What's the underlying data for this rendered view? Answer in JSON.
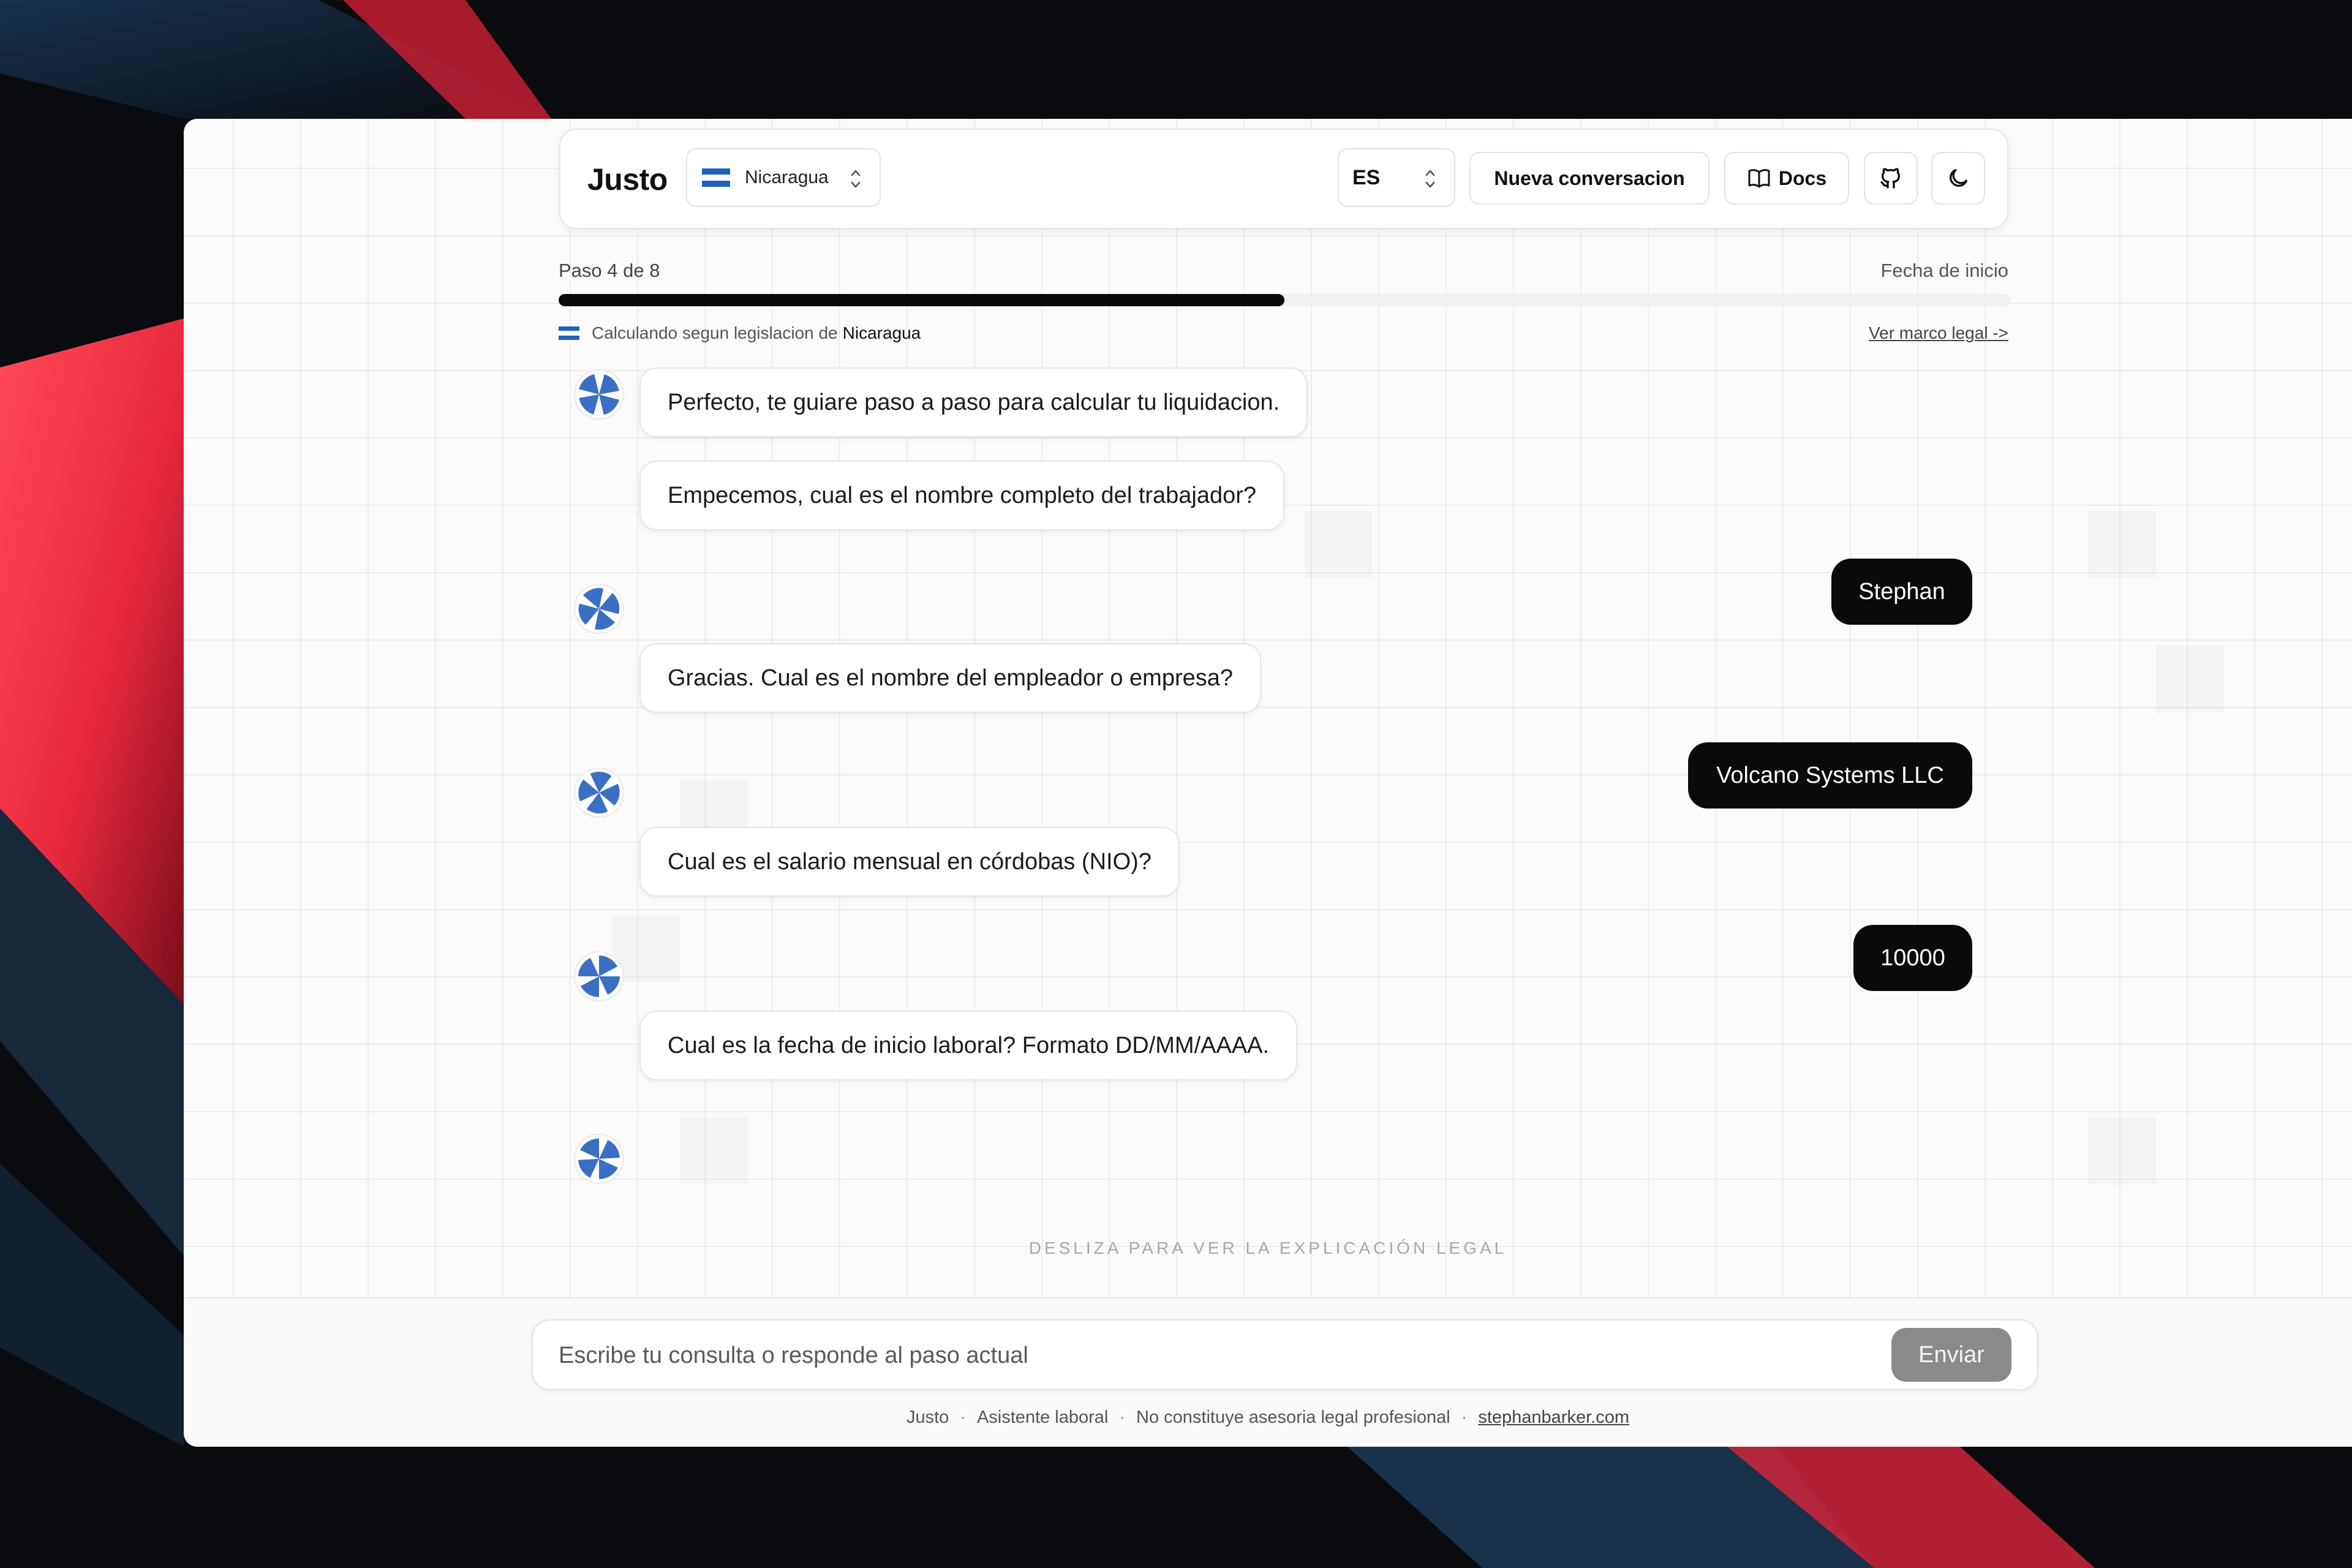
{
  "app": {
    "brand": "Justo",
    "country_selector": {
      "value": "Nicaragua"
    },
    "language_selector": {
      "value": "ES"
    },
    "buttons": {
      "new_conversation": "Nueva conversacion",
      "docs": "Docs"
    },
    "icons": {
      "github": "github-icon",
      "theme": "moon-icon",
      "docs": "book-icon",
      "flag": "nicaragua-flag-icon"
    }
  },
  "progress": {
    "step_label": "Paso 4 de 8",
    "current_field": "Fecha de inicio",
    "fraction": 0.5
  },
  "jurisdiction": {
    "prefix": "Calculando segun legislacion de",
    "country": "Nicaragua",
    "legal_link": "Ver marco legal ->"
  },
  "messages": [
    {
      "role": "bot",
      "text": "Perfecto, te guiare paso a paso para calcular tu liquidacion."
    },
    {
      "role": "bot",
      "text": "Empecemos, cual es el nombre completo del trabajador?"
    },
    {
      "role": "user",
      "text": "Stephan"
    },
    {
      "role": "bot",
      "text": "Gracias. Cual es el nombre del empleador o empresa?"
    },
    {
      "role": "user",
      "text": "Volcano Systems LLC"
    },
    {
      "role": "bot",
      "text": "Cual es el salario mensual en córdobas (NIO)?"
    },
    {
      "role": "user",
      "text": "10000"
    },
    {
      "role": "bot",
      "text": "Cual es la fecha de inicio laboral? Formato DD/MM/AAAA."
    }
  ],
  "swipe_hint": "DESLIZA PARA VER LA EXPLICACIÓN LEGAL",
  "composer": {
    "placeholder": "Escribe tu consulta o responde al paso actual",
    "send_label": "Enviar"
  },
  "footer": {
    "items": [
      "Justo",
      "Asistente laboral",
      "No constituye asesoria legal profesional"
    ],
    "link": "stephanbarker.com"
  },
  "colors": {
    "accent_dark": "#0a0a0a",
    "avatar_blue": "#3b6fc4",
    "flag_blue": "#1f5fbf"
  }
}
